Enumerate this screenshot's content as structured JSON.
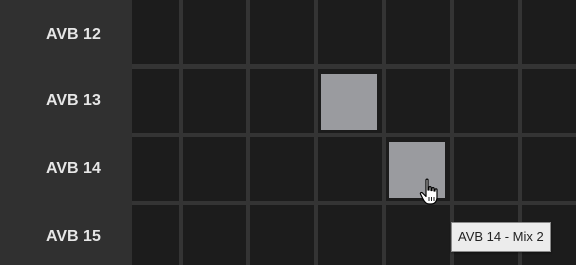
{
  "rows": [
    {
      "label": "AVB 12",
      "active": []
    },
    {
      "label": "AVB 13",
      "active": [
        3
      ]
    },
    {
      "label": "AVB 14",
      "active": [
        4
      ]
    },
    {
      "label": "AVB 15",
      "active": []
    }
  ],
  "column_count": 6,
  "tooltip": {
    "text": "AVB 14 - Mix 2"
  },
  "cursor": {
    "icon": "hand-pointer-icon"
  },
  "colors": {
    "background": "#242424",
    "label_panel": "#303030",
    "cell": "#1c1c1c",
    "active_cell": "#9a9b9f",
    "label_text": "#e6e6e6",
    "tooltip_bg": "#ececec"
  }
}
